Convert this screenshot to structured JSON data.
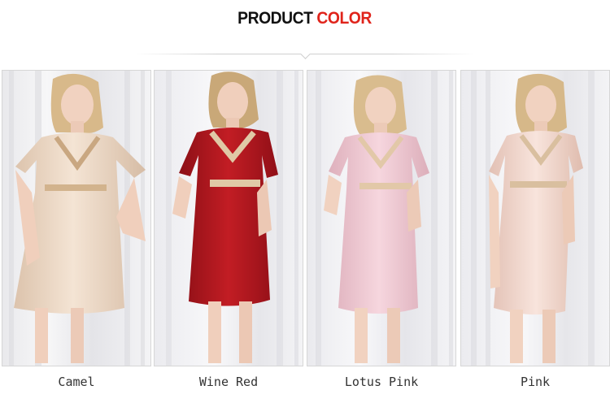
{
  "header": {
    "title_part1": "PRODUCT",
    "title_part2": "COLOR"
  },
  "colors": {
    "title_dark": "#111111",
    "title_accent": "#e0241b"
  },
  "products": [
    {
      "label": "Camel",
      "dress_color": "#ecd7c4",
      "image": "model-camel-dress"
    },
    {
      "label": "Wine Red",
      "dress_color": "#a8141c",
      "image": "model-wine-red-dress"
    },
    {
      "label": "Lotus Pink",
      "dress_color": "#efc9d2",
      "image": "model-lotus-pink-dress"
    },
    {
      "label": "Pink",
      "dress_color": "#f3d9d0",
      "image": "model-pink-dress"
    }
  ]
}
